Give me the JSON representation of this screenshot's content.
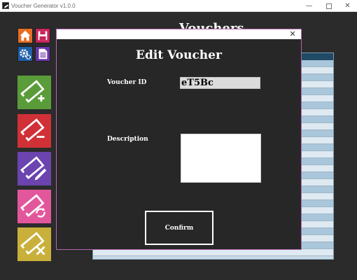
{
  "window": {
    "title": "Voucher Generator v1.0.0",
    "minimize_glyph": "—",
    "close_glyph": "✕"
  },
  "background": {
    "page_title": "Vouchers"
  },
  "sidebar": {
    "small_buttons": [
      {
        "icon": "home-icon",
        "color": "#e86d23"
      },
      {
        "icon": "save-icon",
        "color": "#c8245a"
      },
      {
        "icon": "settings-icon",
        "color": "#1f5fa8"
      },
      {
        "icon": "document-icon",
        "color": "#6a36a8"
      }
    ],
    "big_buttons": [
      {
        "icon": "add-voucher-icon",
        "color": "#5a9c3a"
      },
      {
        "icon": "remove-voucher-icon",
        "color": "#d03137"
      },
      {
        "icon": "edit-voucher-icon",
        "color": "#6b44b0"
      },
      {
        "icon": "refresh-voucher-icon",
        "color": "#e2579c"
      },
      {
        "icon": "delete-voucher-icon",
        "color": "#c9b03a"
      }
    ]
  },
  "dialog": {
    "close_glyph": "✕",
    "heading": "Edit Voucher",
    "voucher_id_label": "Voucher ID",
    "voucher_id_value": "eT5Bc",
    "description_label": "Description",
    "description_value": "",
    "confirm_label": "Confirm"
  },
  "colors": {
    "app_background": "#2b2b2b",
    "dialog_background": "#272727",
    "dialog_border": "#b467b4",
    "table_header": "#204a66",
    "table_row_alt": "#aac6da"
  }
}
